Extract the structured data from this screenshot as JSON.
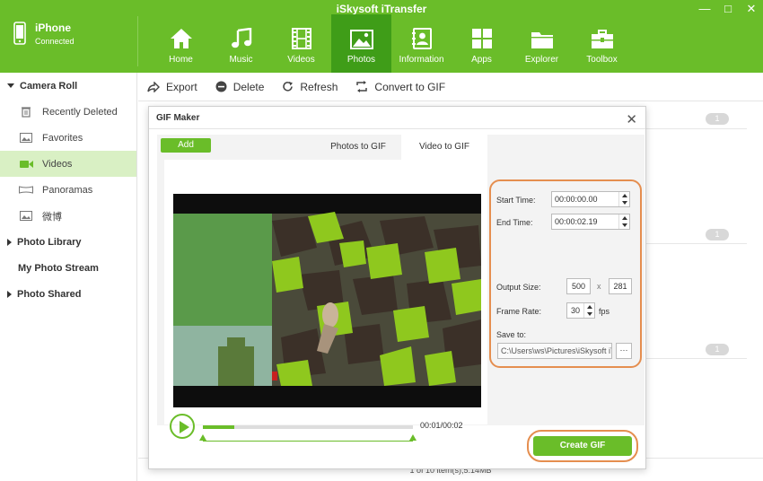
{
  "app": {
    "title": "iSkysoft iTransfer"
  },
  "window": {
    "minimize": "—",
    "maximize": "□",
    "close": "✕"
  },
  "device": {
    "name": "iPhone",
    "status": "Connected"
  },
  "nav": [
    {
      "label": "Home",
      "icon": "home-icon"
    },
    {
      "label": "Music",
      "icon": "music-icon"
    },
    {
      "label": "Videos",
      "icon": "film-icon"
    },
    {
      "label": "Photos",
      "icon": "photo-icon",
      "active": true
    },
    {
      "label": "Information",
      "icon": "contacts-icon"
    },
    {
      "label": "Apps",
      "icon": "apps-icon"
    },
    {
      "label": "Explorer",
      "icon": "folder-icon"
    },
    {
      "label": "Toolbox",
      "icon": "toolbox-icon"
    }
  ],
  "sidebar": {
    "camera_roll": "Camera Roll",
    "items": [
      {
        "label": "Recently Deleted",
        "icon": "trash-icon"
      },
      {
        "label": "Favorites",
        "icon": "image-icon"
      },
      {
        "label": "Videos",
        "icon": "video-icon",
        "active": true
      },
      {
        "label": "Panoramas",
        "icon": "panorama-icon"
      },
      {
        "label": "微博",
        "icon": "image-icon"
      }
    ],
    "photo_library": "Photo Library",
    "my_photo_stream": "My Photo Stream",
    "photo_shared": "Photo Shared"
  },
  "toolbar": {
    "export": "Export",
    "delete": "Delete",
    "refresh": "Refresh",
    "convert_gif": "Convert to GIF"
  },
  "list_badges": [
    "1",
    "1",
    "1"
  ],
  "status_bar": "1 of 10 item(s),5.14MB",
  "dialog": {
    "title": "GIF Maker",
    "close": "✕",
    "add": "Add",
    "tab_photos": "Photos to GIF",
    "tab_video": "Video to GIF",
    "time_display": "00:01/00:02",
    "progress_fraction": 0.15,
    "start_time_label": "Start Time:",
    "start_time": "00:00:00.00",
    "end_time_label": "End Time:",
    "end_time": "00:00:02.19",
    "output_size_label": "Output Size:",
    "width": "500",
    "size_sep": "x",
    "height": "281",
    "frame_rate_label": "Frame Rate:",
    "frame_rate": "30",
    "fps": "fps",
    "save_to_label": "Save to:",
    "save_path": "C:\\Users\\ws\\Pictures\\iSkysoft iTra",
    "browse": "···",
    "create": "Create GIF"
  },
  "colors": {
    "brand": "#6abd29",
    "brand_dark": "#3f9d18",
    "highlight": "#e58e4f"
  }
}
